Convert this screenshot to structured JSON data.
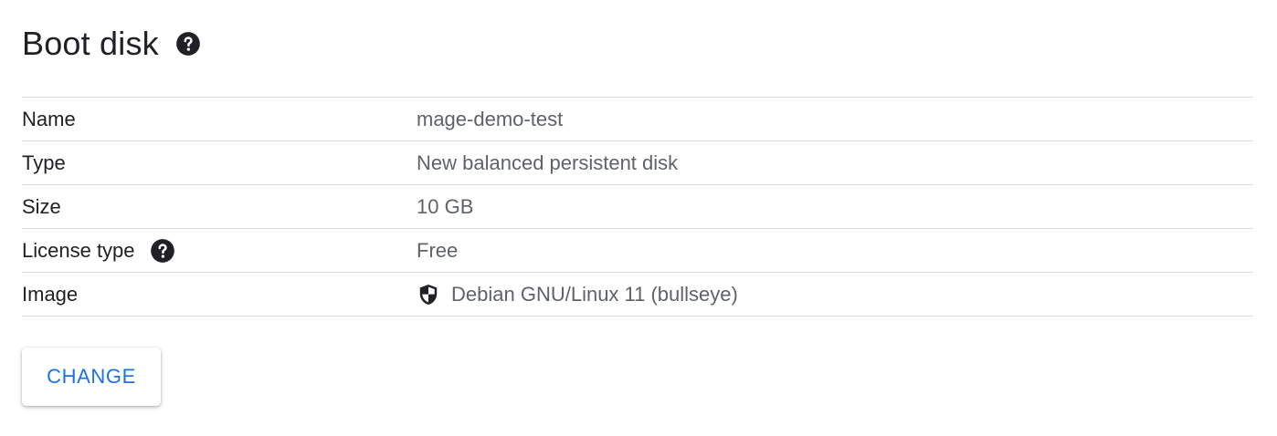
{
  "section": {
    "title": "Boot disk",
    "title_help_icon": "help-circle-icon"
  },
  "rows": [
    {
      "label": "Name",
      "value": "mage-demo-test"
    },
    {
      "label": "Type",
      "value": "New balanced persistent disk"
    },
    {
      "label": "Size",
      "value": "10 GB"
    },
    {
      "label": "License type",
      "label_icon": "help-circle-icon",
      "value": "Free"
    },
    {
      "label": "Image",
      "value_icon": "shield-icon",
      "value": "Debian GNU/Linux 11 (bullseye)"
    }
  ],
  "actions": {
    "change_label": "CHANGE"
  },
  "colors": {
    "accent": "#1a73e8",
    "text_primary": "#202124",
    "text_secondary": "#5f6368",
    "divider": "#dadce0"
  }
}
